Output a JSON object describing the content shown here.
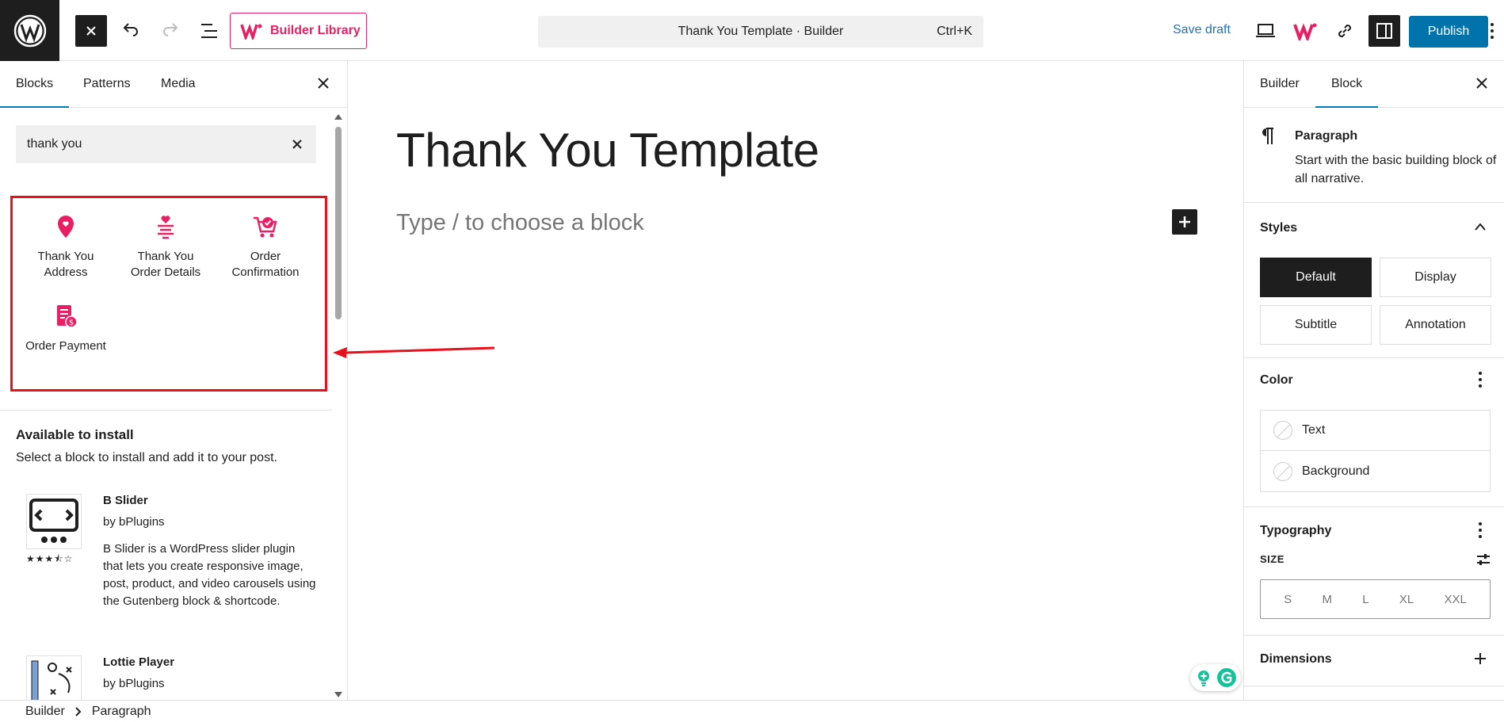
{
  "topbar": {
    "builder_library_label": "Builder Library",
    "command_title": "Thank You Template · Builder",
    "command_shortcut": "Ctrl+K",
    "save_draft_label": "Save draft",
    "publish_label": "Publish",
    "icons": [
      "wordpress-logo-icon",
      "close-icon",
      "undo-icon",
      "redo-icon",
      "list-view-icon",
      "builder-logo-icon",
      "desktop-view-icon",
      "link-icon",
      "settings-sidebar-icon",
      "more-vertical-icon"
    ]
  },
  "inserter": {
    "tabs": [
      "Blocks",
      "Patterns",
      "Media"
    ],
    "active_tab": "Blocks",
    "search_value": "thank you",
    "results": [
      {
        "label_line1": "Thank You",
        "label_line2": "Address",
        "icon": "location-pin-icon"
      },
      {
        "label_line1": "Thank You",
        "label_line2": "Order Details",
        "icon": "order-details-icon"
      },
      {
        "label_line1": "Order",
        "label_line2": "Confirmation",
        "icon": "cart-check-icon"
      },
      {
        "label_line1": "Order Payment",
        "label_line2": "",
        "icon": "payment-receipt-icon"
      }
    ],
    "available_title": "Available to install",
    "available_desc": "Select a block to install and add it to your post.",
    "plugins": [
      {
        "name": "B Slider",
        "by": "by bPlugins",
        "desc": "B Slider is a WordPress slider plugin that lets you create responsive image, post, product, and video carousels using the Gutenberg block & shortcode.",
        "rating": 3.5
      },
      {
        "name": "Lottie Player",
        "by": "by bPlugins"
      }
    ]
  },
  "canvas": {
    "title": "Thank You Template",
    "placeholder": "Type / to choose a block"
  },
  "settings": {
    "tabs": [
      "Builder",
      "Block"
    ],
    "active_tab": "Block",
    "block_name": "Paragraph",
    "block_desc": "Start with the basic building block of all narrative.",
    "styles_title": "Styles",
    "styles": [
      "Default",
      "Display",
      "Subtitle",
      "Annotation"
    ],
    "active_style": "Default",
    "color_title": "Color",
    "colors": [
      "Text",
      "Background"
    ],
    "typography_title": "Typography",
    "size_label": "SIZE",
    "sizes": [
      "S",
      "M",
      "L",
      "XL",
      "XXL"
    ],
    "dimensions_title": "Dimensions"
  },
  "breadcrumb": [
    "Builder",
    "Paragraph"
  ],
  "colors": {
    "accent": "#e91e63",
    "primary": "#0073aa",
    "highlight": "#e8101a"
  }
}
